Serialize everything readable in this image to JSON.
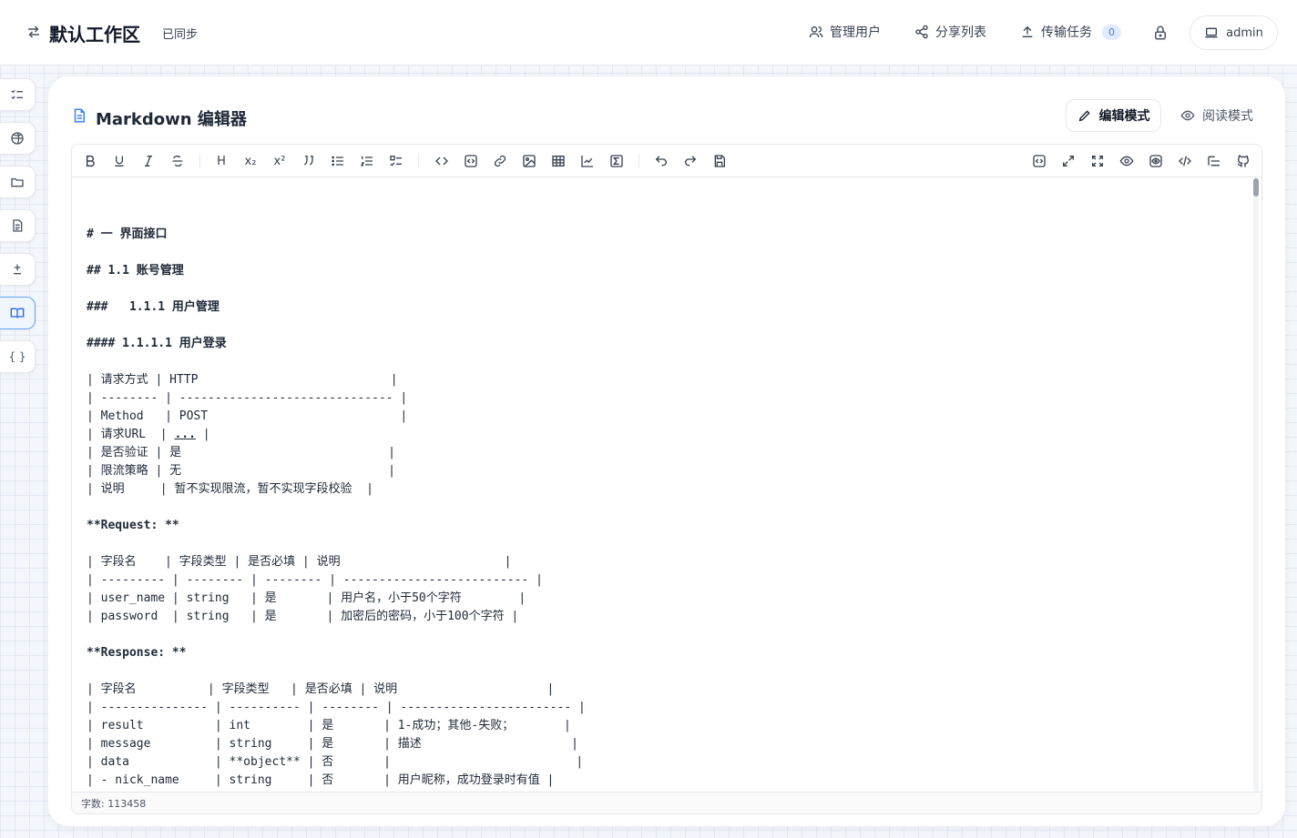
{
  "header": {
    "workspace_title": "默认工作区",
    "sync_status": "已同步",
    "manage_users": "管理用户",
    "share_list": "分享列表",
    "transfer_tasks": "传输任务",
    "transfer_count": "0",
    "user": "admin"
  },
  "rail": {
    "items": [
      "list-check-icon",
      "globe-icon",
      "folder-icon",
      "document-icon",
      "plus-minus-icon",
      "book-open-icon",
      "braces-icon"
    ],
    "braces_label": "{ }",
    "active_index": 5
  },
  "card": {
    "title": "Markdown 编辑器",
    "edit_mode": "编辑模式",
    "read_mode": "阅读模式"
  },
  "toolbar": {
    "heading_label": "H",
    "sub_label": "x₂",
    "sup_label": "x²"
  },
  "editor": {
    "lines": [
      "# 一 界面接口",
      "## 1.1 账号管理",
      "###   1.1.1 用户管理",
      "#### 1.1.1.1 用户登录",
      "| 请求方式 | HTTP                           |",
      "| -------- | ------------------------------ |",
      "| Method   | POST                           |",
      "| 请求URL  | ",
      "| 是否验证 | 是                             |",
      "| 限流策略 | 无                             |",
      "| 说明     | 暂不实现限流，暂不实现字段校验  |",
      "**Request: **",
      "| 字段名    | 字段类型 | 是否必填 | 说明                       |",
      "| --------- | -------- | -------- | -------------------------- |",
      "| user_name | string   | 是       | 用户名，小于50个字符        |",
      "| password  | string   | 是       | 加密后的密码，小于100个字符 |",
      "**Response: **",
      "| 字段名          | 字段类型   | 是否必填 | 说明                     |",
      "| --------------- | ---------- | -------- | ------------------------ |",
      "| result          | int        | 是       | 1-成功；其他-失败；       |",
      "| message         | string     | 是       | 描述                     |",
      "| data            | **object** | 否       |                          |",
      "| - nick_name     | string     | 否       | 用户昵称，成功登录时有值 |"
    ],
    "url_link": "...",
    "url_tail": " |",
    "word_count": "字数: 113458"
  }
}
